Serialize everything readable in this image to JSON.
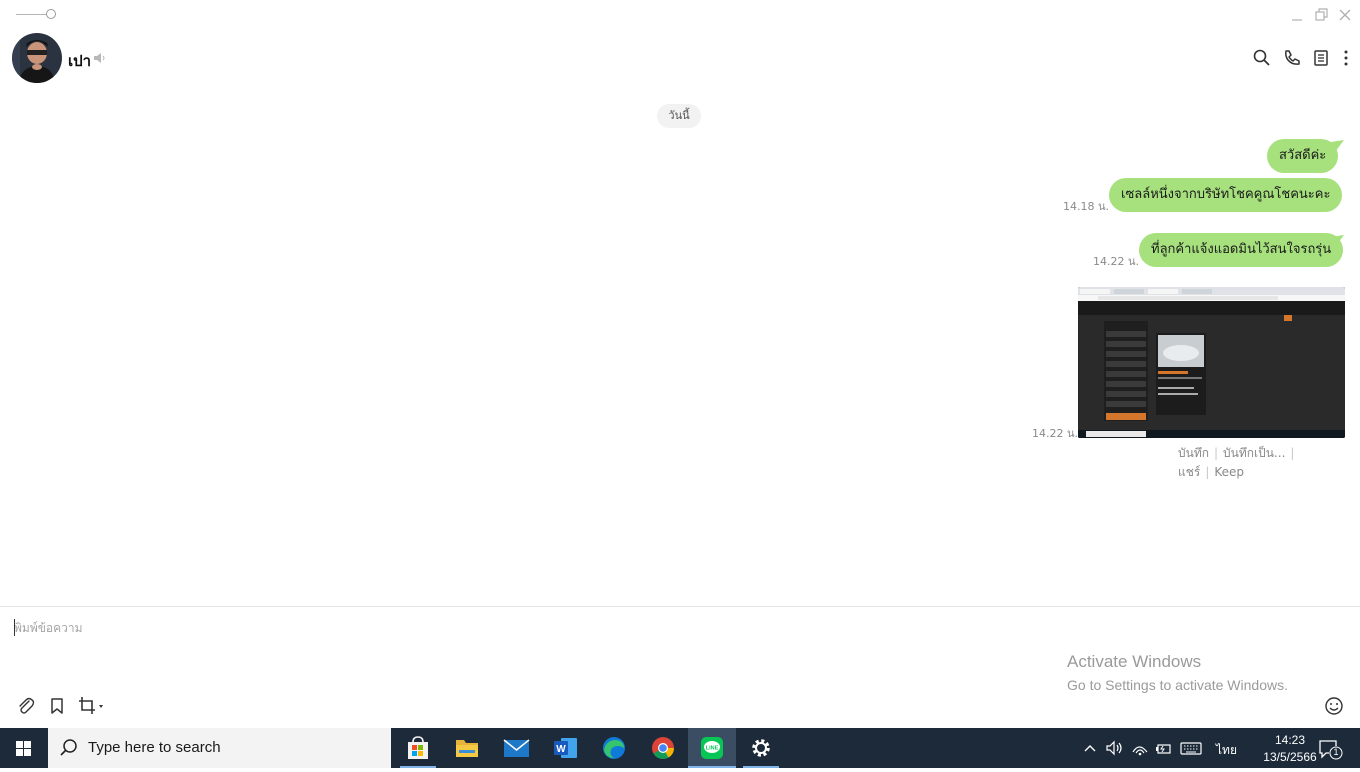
{
  "header": {
    "contact_name": "เปา"
  },
  "date_divider": "วันนี้",
  "messages": [
    {
      "text": "สวัสดีค่ะ",
      "time": ""
    },
    {
      "text": "เซลล์หนึ่งจากบริษัทโชคคูณโชคนะคะ",
      "time": "14.18 น."
    },
    {
      "text": "ที่ลูกค้าแจ้งแอดมินไว้สนใจรถรุ่น",
      "time": "14.22 น."
    }
  ],
  "image_message": {
    "time": "14.22 น.",
    "actions": [
      "บันทึก",
      "บันทึกเป็น...",
      "แชร์",
      "Keep"
    ]
  },
  "composer": {
    "placeholder": "พิมพ์ข้อความ"
  },
  "watermark": {
    "line1": "Activate Windows",
    "line2": "Go to Settings to activate Windows."
  },
  "taskbar": {
    "search_placeholder": "Type here to search",
    "language": "ไทย",
    "time": "14:23",
    "date": "13/5/2566",
    "notification_count": "1",
    "apps": [
      "microsoft-store",
      "file-explorer",
      "mail",
      "word",
      "edge",
      "chrome",
      "line",
      "settings"
    ],
    "active_app": "line"
  },
  "colors": {
    "bubble": "#a6e17d",
    "taskbar": "#1c2a3a",
    "line_green": "#06c755"
  }
}
